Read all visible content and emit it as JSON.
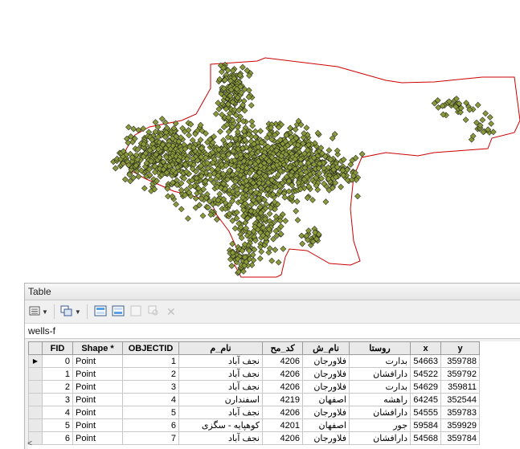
{
  "map": {
    "layer_name": "wells-f",
    "boundary_color": "#cc0000",
    "point_fill": "#8a9a3a",
    "point_stroke": "#1a1a1a"
  },
  "table_window": {
    "title": "Table",
    "layer_tab": "wells-f",
    "toolbar_icons": [
      "table-options-icon",
      "related-tables-icon",
      "select-by-attributes-icon",
      "switch-selection-icon",
      "clear-selection-icon",
      "zoom-to-selected-icon",
      "delete-selected-icon"
    ],
    "columns": [
      "FID",
      "Shape *",
      "OBJECTID",
      "نام_م",
      "کد_مح",
      "نام_ش",
      "روستا",
      "x",
      "y"
    ],
    "rows": [
      [
        "0",
        "Point",
        "1",
        "نجف آباد",
        "4206",
        "فلاورجان",
        "بدارت",
        "54663",
        "359788"
      ],
      [
        "1",
        "Point",
        "2",
        "نجف آباد",
        "4206",
        "فلاورجان",
        "دارافشان",
        "54522",
        "359792"
      ],
      [
        "2",
        "Point",
        "3",
        "نجف آباد",
        "4206",
        "فلاورجان",
        "بدارت",
        "54629",
        "359811"
      ],
      [
        "3",
        "Point",
        "4",
        "اسفندارن",
        "4219",
        "اصفهان",
        "راهشه",
        "64245",
        "352544"
      ],
      [
        "4",
        "Point",
        "5",
        "نجف آباد",
        "4206",
        "فلاورجان",
        "دارافشان",
        "54555",
        "359783"
      ],
      [
        "5",
        "Point",
        "6",
        "کوهپایه - سگزی",
        "4201",
        "اصفهان",
        "جور",
        "59584",
        "359929"
      ],
      [
        "6",
        "Point",
        "7",
        "نجف آباد",
        "4206",
        "فلاورجان",
        "دارافشان",
        "54568",
        "359784"
      ]
    ]
  }
}
